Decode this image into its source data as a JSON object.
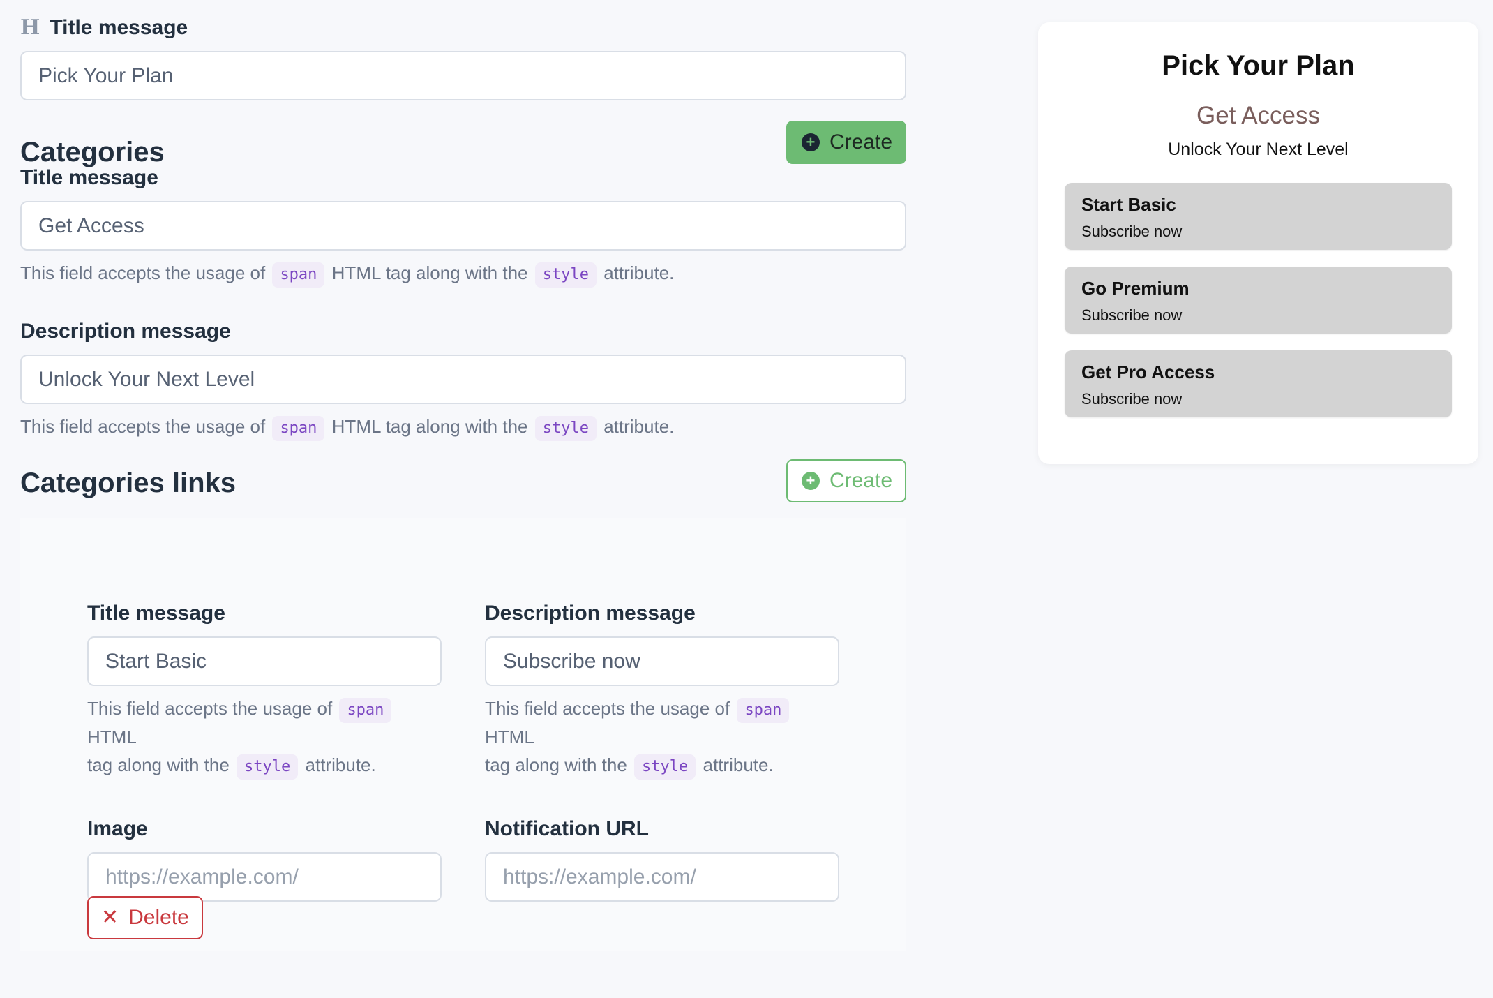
{
  "form": {
    "title_field": {
      "label": "Title message",
      "value": "Pick Your Plan"
    },
    "categories": {
      "heading": "Categories",
      "create_label": "Create",
      "title_field": {
        "label": "Title message",
        "value": "Get Access"
      },
      "description_field": {
        "label": "Description message",
        "value": "Unlock Your Next Level"
      }
    },
    "help": {
      "prefix": "This field accepts the usage of",
      "tag": "span",
      "middle": "HTML tag along with the",
      "attr": "style",
      "suffix": "attribute."
    },
    "help_wrapped": {
      "line1_prefix": "This field accepts the usage of",
      "line1_suffix": "HTML",
      "line2_prefix": "tag along with the",
      "line2_suffix": "attribute."
    },
    "categories_links": {
      "heading": "Categories links",
      "create_label": "Create",
      "item": {
        "title_field": {
          "label": "Title message",
          "value": "Start Basic"
        },
        "description_field": {
          "label": "Description message",
          "value": "Subscribe now"
        },
        "image_field": {
          "label": "Image",
          "placeholder": "https://example.com/"
        },
        "notification_field": {
          "label": "Notification URL",
          "placeholder": "https://example.com/"
        },
        "delete_label": "Delete"
      }
    }
  },
  "preview": {
    "title": "Pick Your Plan",
    "subtitle": "Get Access",
    "description": "Unlock Your Next Level",
    "items": [
      {
        "title": "Start Basic",
        "subtitle": "Subscribe now"
      },
      {
        "title": "Go Premium",
        "subtitle": "Subscribe now"
      },
      {
        "title": "Get Pro Access",
        "subtitle": "Subscribe now"
      }
    ]
  },
  "colors": {
    "accent_green": "#6dbb73",
    "danger_red": "#c9393e"
  },
  "icons": {
    "title_field": "heading-icon",
    "create": "plus-circle-icon",
    "delete": "close-icon"
  }
}
